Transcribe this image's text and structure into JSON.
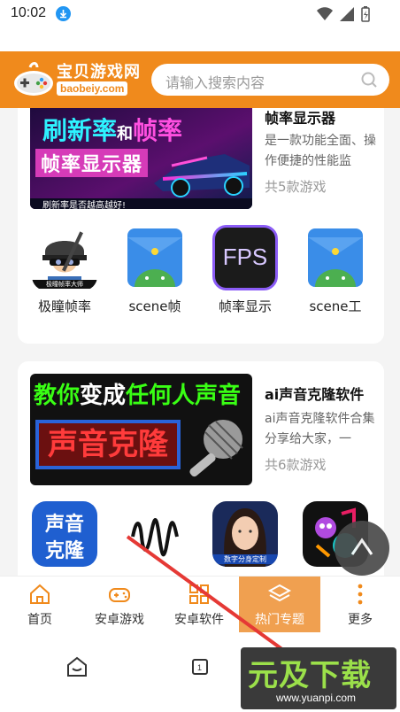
{
  "status_bar": {
    "time": "10:02"
  },
  "header": {
    "logo_name": "宝贝游戏网",
    "logo_domain": "baobeiy.com",
    "search_placeholder": "请输入搜索内容"
  },
  "topics": [
    {
      "title": "帧率显示器",
      "desc": "是一款功能全面、操作便捷的性能监",
      "count": "共5款游戏",
      "banner": {
        "line1_a": "刷新率",
        "line1_b": "和",
        "line1_c": "帧率",
        "line2": "帧率显示器",
        "footer": "刷新率是否越高越好!"
      },
      "apps": [
        {
          "name": "极瞳帧率",
          "icon_caption": "极瞳帧率大师",
          "icon": "pubg-helmet-icon"
        },
        {
          "name": "scene帧",
          "icon": "android-folder-icon"
        },
        {
          "name": "帧率显示",
          "icon": "fps-icon",
          "icon_text": "FPS"
        },
        {
          "name": "scene工",
          "icon": "android-folder-icon"
        }
      ]
    },
    {
      "title": "ai声音克隆软件",
      "desc": "ai声音克隆软件合集分享给大家，一",
      "count": "共6款游戏",
      "banner": {
        "line1_a": "教你",
        "line1_b": "变成",
        "line1_c": "任何人声音",
        "line2": "声音克隆"
      },
      "apps": [
        {
          "name": "",
          "icon": "voice-clone-icon",
          "icon_text1": "声音",
          "icon_text2": "克隆"
        },
        {
          "name": "",
          "icon": "soundwave-icon"
        },
        {
          "name": "",
          "icon": "digital-human-icon",
          "icon_caption": "数字分身定制"
        },
        {
          "name": "",
          "icon": "music-monster-icon"
        }
      ]
    }
  ],
  "bottom_nav": [
    {
      "label": "首页",
      "icon": "home-icon"
    },
    {
      "label": "安卓游戏",
      "icon": "gamepad-icon"
    },
    {
      "label": "安卓软件",
      "icon": "grid-icon"
    },
    {
      "label": "热门专题",
      "icon": "layers-icon",
      "active": true
    },
    {
      "label": "更多",
      "icon": "more-icon"
    }
  ],
  "watermark": {
    "main": "元及下载",
    "url": "www.yuanpi.com"
  }
}
